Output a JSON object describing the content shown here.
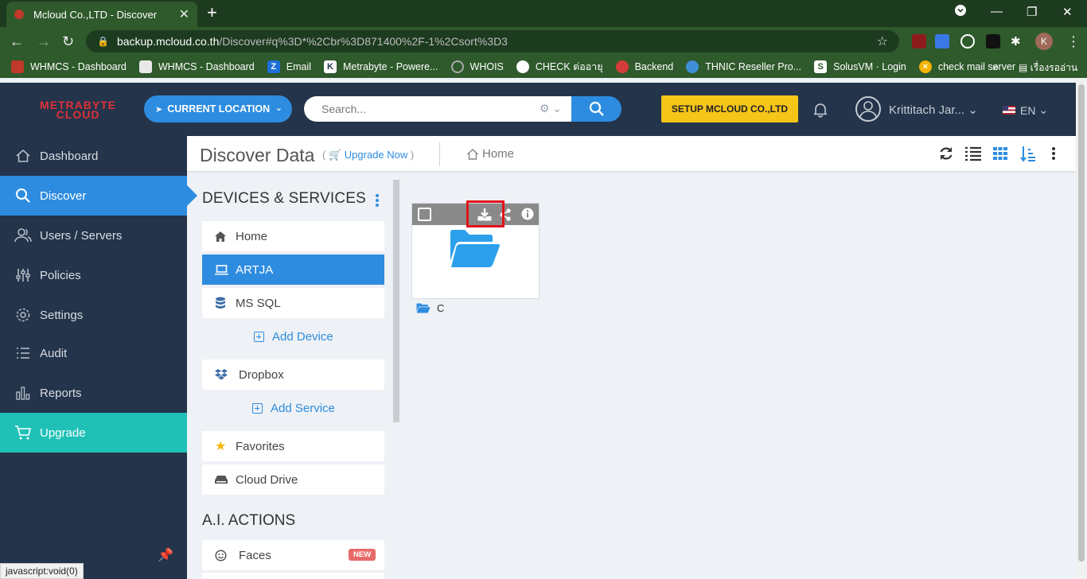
{
  "browser": {
    "tab_title": "Mcloud Co.,LTD - Discover",
    "url_host": "backup.mcloud.co.th",
    "url_path": "/Discover#q%3D*%2Cbr%3D871400%2F-1%2Csort%3D3",
    "profile_initial": "K",
    "bookmarks": [
      {
        "label": "WHMCS - Dashboard",
        "color": "#c0392b"
      },
      {
        "label": "WHMCS - Dashboard",
        "color": "#e9e9e9"
      },
      {
        "label": "Email",
        "color": "#1e6fd9"
      },
      {
        "label": "Metrabyte - Powere...",
        "color": "#ffffff"
      },
      {
        "label": "WHOIS",
        "color": "#7a7a7a"
      },
      {
        "label": "CHECK ต่ออายุ",
        "color": "#ffffff"
      },
      {
        "label": "Backend",
        "color": "#d63b3b"
      },
      {
        "label": "THNIC Reseller Pro...",
        "color": "#3f8fd8"
      },
      {
        "label": "SolusVM · Login",
        "color": "#ffffff"
      },
      {
        "label": "check mail server",
        "color": "#f4b400"
      }
    ],
    "bookmarks_more": "»",
    "reading_list": "เรื่องรออ่าน",
    "status_text": "javascript:void(0)"
  },
  "header": {
    "logo_line1": "METRABYTE",
    "logo_line2": "CLOUD",
    "location_label": "CURRENT LOCATION",
    "search_placeholder": "Search...",
    "setup_label": "SETUP MCLOUD CO.,LTD",
    "user_name": "Krittitach Jar...",
    "lang": "EN"
  },
  "sidebar": {
    "items": [
      {
        "label": "Dashboard"
      },
      {
        "label": "Discover"
      },
      {
        "label": "Users / Servers"
      },
      {
        "label": "Policies"
      },
      {
        "label": "Settings"
      },
      {
        "label": "Audit"
      },
      {
        "label": "Reports"
      },
      {
        "label": "Upgrade"
      }
    ]
  },
  "content": {
    "title": "Discover Data",
    "upgrade_open": "(",
    "upgrade_label": "Upgrade Now",
    "upgrade_close": ")",
    "breadcrumb": "Home"
  },
  "panel": {
    "title": "DEVICES & SERVICES",
    "devices": [
      {
        "label": "Home"
      },
      {
        "label": "ARTJA"
      },
      {
        "label": "MS SQL"
      }
    ],
    "add_device": "Add Device",
    "services": [
      {
        "label": "Dropbox"
      }
    ],
    "add_service": "Add Service",
    "extras": [
      {
        "label": "Favorites"
      },
      {
        "label": "Cloud Drive"
      }
    ],
    "ai_title": "A.I. ACTIONS",
    "ai_items": [
      {
        "label": "Faces",
        "badge": "NEW"
      }
    ]
  },
  "files": [
    {
      "name": "C"
    }
  ],
  "colors": {
    "accent": "#2d8ce0",
    "sidebar_bg": "#24344a",
    "upgrade": "#1fc1b6",
    "setup_button": "#f5c518",
    "highlight": "#e2121b"
  }
}
